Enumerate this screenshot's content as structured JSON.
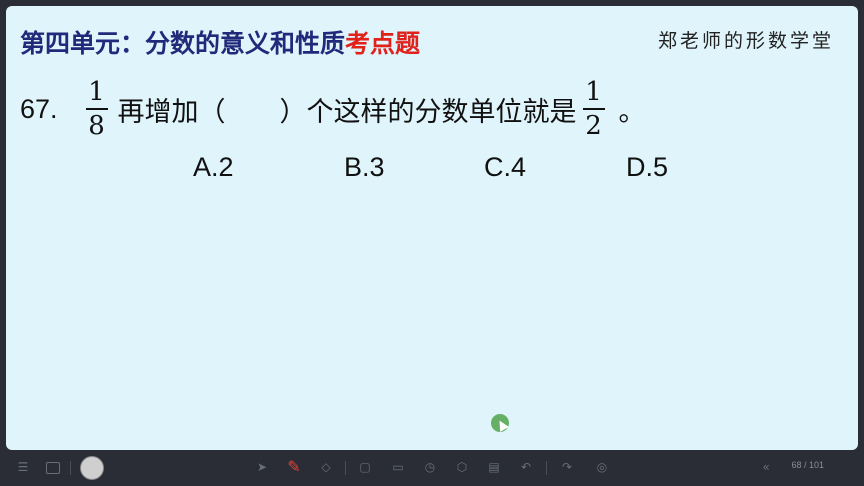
{
  "slide": {
    "title_main": "第四单元：分数的意义和性质",
    "title_highlight": "考点题",
    "brand": "郑老师的形数学堂",
    "question": {
      "number": "67.",
      "fraction1": {
        "numerator": "1",
        "denominator": "8"
      },
      "text_before": "再增加（　　）个这样的分数单位就是",
      "fraction2": {
        "numerator": "1",
        "denominator": "2"
      },
      "text_end": "。"
    },
    "options": [
      "A.2",
      "B.3",
      "C.4",
      "D.5"
    ]
  },
  "toolbar": {
    "page_indicator": "68 / 101",
    "icons": [
      "menu-icon",
      "screen-icon",
      "avatar",
      "pointer-icon",
      "pen-icon",
      "eraser-icon",
      "shapes-icon",
      "whiteboard-icon",
      "timer-icon",
      "tools-icon",
      "video-icon",
      "undo-icon",
      "redo-icon",
      "record-icon",
      "prev-page-icon"
    ]
  },
  "colors": {
    "title": "#1f2a7a",
    "highlight": "#e0221b",
    "background": "#dff4fb",
    "toolbar": "#2a2d36"
  }
}
